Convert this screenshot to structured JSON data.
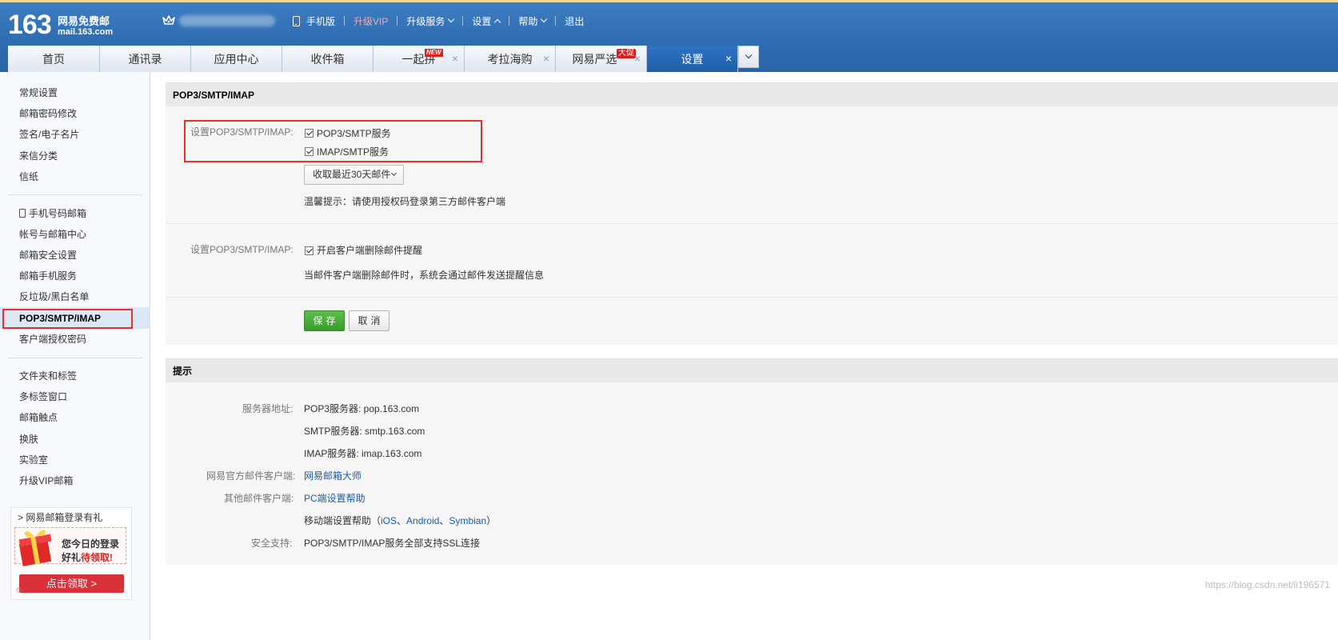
{
  "header": {
    "logo_number": "163",
    "logo_name": "网易免费邮",
    "logo_domain": "mail.163.com",
    "topnav": {
      "mobile": "手机版",
      "vip": "升级VIP",
      "services": "升级服务",
      "settings": "设置",
      "help": "帮助",
      "logout": "退出"
    }
  },
  "tabs": [
    {
      "label": "首页"
    },
    {
      "label": "通讯录"
    },
    {
      "label": "应用中心"
    },
    {
      "label": "收件箱"
    },
    {
      "label": "一起拼",
      "badge": "NEW"
    },
    {
      "label": "考拉海购"
    },
    {
      "label": "网易严选",
      "badge": "大促"
    },
    {
      "label": "设置"
    }
  ],
  "tab_close_glyph": "×",
  "sidebar": {
    "group1": [
      "常规设置",
      "邮箱密码修改",
      "签名/电子名片",
      "来信分类",
      "信纸"
    ],
    "group2": [
      "手机号码邮箱",
      "帐号与邮箱中心",
      "邮箱安全设置",
      "邮箱手机服务",
      "反垃圾/黑白名单",
      "POP3/SMTP/IMAP",
      "客户端授权密码"
    ],
    "group3": [
      "文件夹和标签",
      "多标签窗口",
      "邮箱触点",
      "换肤",
      "实验室",
      "升级VIP邮箱"
    ],
    "promo": {
      "title": "网易邮箱登录有礼",
      "line1": "您今日的登录",
      "line2_prefix": "好礼",
      "line2_highlight": "待领取!",
      "button": "点击领取 >"
    }
  },
  "pop_section": {
    "title": "POP3/SMTP/IMAP",
    "row1_label": "设置POP3/SMTP/IMAP:",
    "opt_pop3": "POP3/SMTP服务",
    "opt_imap": "IMAP/SMTP服务",
    "select_value": "收取最近30天邮件",
    "hint": "温馨提示：请使用授权码登录第三方邮件客户端",
    "row2_label": "设置POP3/SMTP/IMAP:",
    "opt_delete_alert": "开启客户端删除邮件提醒",
    "delete_alert_desc": "当邮件客户端删除邮件时，系统会通过邮件发送提醒信息",
    "save": "保存",
    "cancel": "取消"
  },
  "tips_section": {
    "title": "提示",
    "server_label": "服务器地址:",
    "pop3_server": "POP3服务器: pop.163.com",
    "smtp_server": "SMTP服务器: smtp.163.com",
    "imap_server": "IMAP服务器: imap.163.com",
    "official_client_label": "网易官方邮件客户端:",
    "official_client_link": "网易邮箱大师",
    "other_client_label": "其他邮件客户端:",
    "pc_help_link": "PC端设置帮助",
    "mobile_help_prefix": "移动端设置帮助（",
    "ios": "iOS",
    "sep1": "、",
    "android": "Android",
    "sep2": "、",
    "symbian": "Symbian",
    "mobile_help_suffix": "）",
    "ssl_label": "安全支持:",
    "ssl_text": "POP3/SMTP/IMAP服务全部支持SSL连接"
  },
  "watermark": "https://blog.csdn.net/li196571",
  "colors": {
    "header_blue": "#2f6db3",
    "active_tab": "#1f5ea8",
    "highlight_red": "#e8302b",
    "save_green": "#3a9b2c",
    "link_blue": "#1a5ea8"
  }
}
